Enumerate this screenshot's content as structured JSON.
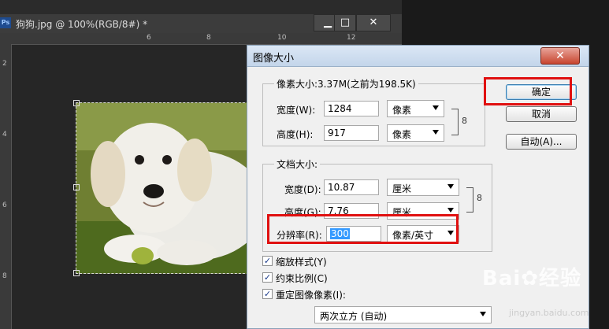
{
  "document": {
    "title": "狗狗.jpg @ 100%(RGB/8#) *",
    "ps_logo": "Ps",
    "min_glyph": "▁",
    "max_glyph": "□",
    "close_glyph": "✕",
    "ruler_top_ticks": [
      "6",
      "8",
      "10",
      "12"
    ],
    "ruler_left_ticks": [
      "2",
      "4",
      "6",
      "8"
    ]
  },
  "dialog": {
    "title": "图像大小",
    "close_glyph": "✕",
    "pixel_dims": {
      "legend": "像素大小:3.37M(之前为198.5K)",
      "width_label": "宽度(W):",
      "width_value": "1284",
      "width_unit": "像素",
      "height_label": "高度(H):",
      "height_value": "917",
      "height_unit": "像素"
    },
    "doc_size": {
      "legend": "文档大小:",
      "width_label": "宽度(D):",
      "width_value": "10.87",
      "width_unit": "厘米",
      "height_label": "高度(G):",
      "height_value": "7.76",
      "height_unit": "厘米",
      "resolution_label": "分辨率(R):",
      "resolution_value": "300",
      "resolution_unit": "像素/英寸"
    },
    "buttons": {
      "ok": "确定",
      "cancel": "取消",
      "auto": "自动(A)..."
    },
    "checkboxes": [
      {
        "label": "缩放样式(Y)",
        "checked": true
      },
      {
        "label": "约束比例(C)",
        "checked": true
      },
      {
        "label": "重定图像像素(I):",
        "checked": true
      }
    ],
    "resample_method": "两次立方 (自动)",
    "chain_glyph": "8"
  },
  "watermark": {
    "brand": "Bai✿经验",
    "url": "jingyan.baidu.com"
  },
  "colors": {
    "annotation_red": "#e01010",
    "selection_blue": "#3399ff"
  }
}
